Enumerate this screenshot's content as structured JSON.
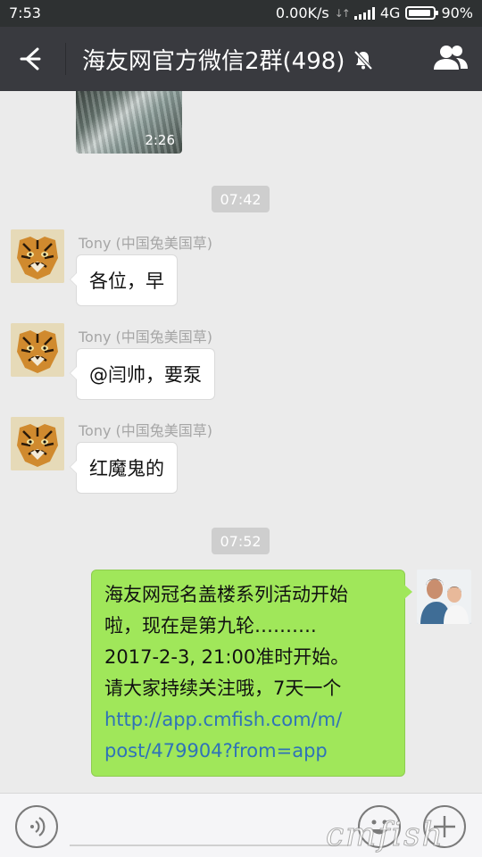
{
  "status_bar": {
    "time": "7:53",
    "speed": "0.00K/s",
    "network": "4G",
    "battery": "90%"
  },
  "header": {
    "title": "海友网官方微信2群(498)",
    "back_icon": "back-arrow-icon",
    "mute_icon": "muted-bell-icon",
    "group_icon": "group-members-icon"
  },
  "messages": {
    "video_duration": "2:26",
    "timestamp_1": "07:42",
    "timestamp_2": "07:52",
    "sender_name": "Tony (中国兔美国草)",
    "left_1": "各位，早",
    "left_2": "@闫帅，要泵",
    "left_3": "红魔鬼的",
    "right_lines": [
      "海友网冠名盖楼系列活动开始",
      "啦，现在是第九轮……….",
      "2017-2-3, 21:00准时开始。",
      "请大家持续关注哦，7天一个"
    ],
    "right_link_lines": [
      "http://app.cmfish.com/m/",
      "post/479904?from=app"
    ]
  },
  "input_bar": {
    "voice_icon": "voice-icon",
    "emoji_icon": "emoji-icon",
    "plus_icon": "plus-icon"
  },
  "watermark": "cmfish",
  "colors": {
    "header_bg": "#393a3f",
    "chat_bg": "#ebebeb",
    "sent_bubble": "#a0e75a",
    "link": "#2f72b8"
  }
}
